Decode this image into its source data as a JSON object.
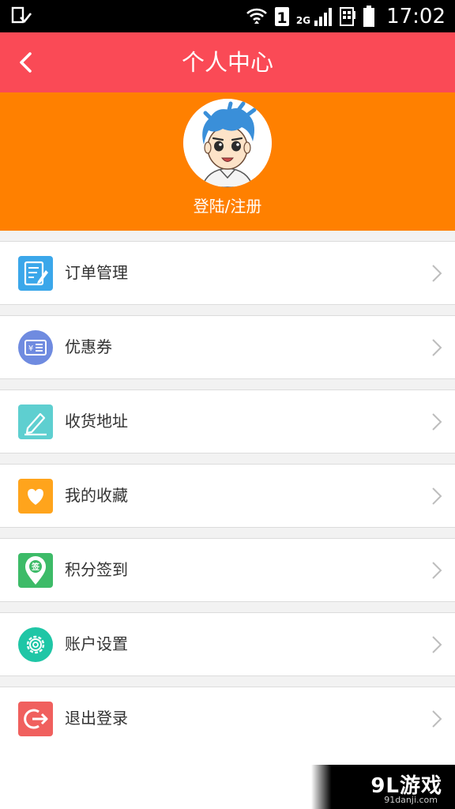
{
  "status_bar": {
    "time": "17:02",
    "network": "2G",
    "sim_badge": "1"
  },
  "header": {
    "title": "个人中心"
  },
  "profile": {
    "login_label": "登陆/注册"
  },
  "menu": [
    {
      "label": "订单管理",
      "icon": "order-icon",
      "color": "#3ba7ea"
    },
    {
      "label": "优惠券",
      "icon": "coupon-icon",
      "color": "#6f8be0"
    },
    {
      "label": "收货地址",
      "icon": "address-edit-icon",
      "color": "#5ecfd0"
    },
    {
      "label": "我的收藏",
      "icon": "favorite-heart-icon",
      "color": "#ffa41c"
    },
    {
      "label": "积分签到",
      "icon": "checkin-pin-icon",
      "color": "#3dbb68"
    },
    {
      "label": "账户设置",
      "icon": "settings-gear-icon",
      "color": "#1fc6a6"
    },
    {
      "label": "退出登录",
      "icon": "logout-icon",
      "color": "#f0605e"
    }
  ],
  "watermark": {
    "logo": "9L游戏",
    "url": "91danji.com"
  },
  "colors": {
    "title_bar": "#fa4a56",
    "profile_bg": "#ff8000"
  }
}
